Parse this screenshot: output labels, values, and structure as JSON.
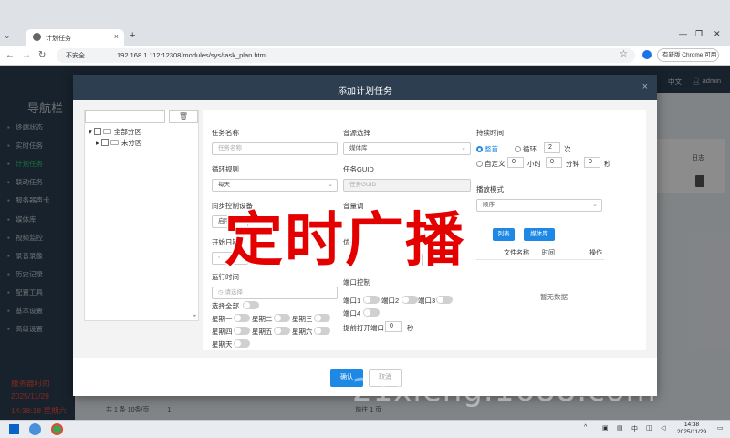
{
  "browser": {
    "tab_title": "计划任务",
    "tab_close": "×",
    "new_tab": "+",
    "window_controls": [
      "—",
      "❐",
      "✕"
    ],
    "insecure_label": "不安全",
    "url": "192.168.1.112:12308/modules/sys/task_plan.html",
    "update_label": "有新版 Chrome 可用"
  },
  "sidebar": {
    "title": "导航栏",
    "items": [
      {
        "label": "终端状态"
      },
      {
        "label": "实时任务"
      },
      {
        "label": "计划任务"
      },
      {
        "label": "联动任务"
      },
      {
        "label": "服务器声卡"
      },
      {
        "label": "媒体库"
      },
      {
        "label": "视频监控"
      },
      {
        "label": "录音录像"
      },
      {
        "label": "历史记录"
      },
      {
        "label": "配置工具"
      },
      {
        "label": "基本设置"
      },
      {
        "label": "高级设置"
      }
    ],
    "server_time_label": "服务器时间",
    "server_date": "2025/11/29",
    "server_clock": "14:38:18 星期六"
  },
  "topbar": {
    "lang": "中文",
    "user": "admin"
  },
  "background": {
    "log_header": "日志",
    "pager_text": "共 1 条   10条/页",
    "pager_page": "1",
    "pager_goto": "前往   1   页"
  },
  "modal": {
    "title": "添加计划任务",
    "close": "×",
    "tree": {
      "root": "全部分区",
      "child": "未分区"
    },
    "form": {
      "task_name_label": "任务名称",
      "task_name_placeholder": "任务名称",
      "source_label": "音源选择",
      "source_value": "媒体库",
      "duration_label": "持续时间",
      "whole_label": "整首",
      "loop_label": "循环",
      "loop_count": "2",
      "loop_unit": "次",
      "custom_label": "自定义",
      "hour_value": "0",
      "hour_unit": "小时",
      "min_value": "0",
      "min_unit": "分钟",
      "sec_value": "0",
      "sec_unit": "秒",
      "cycle_label": "循环规则",
      "cycle_value": "每天",
      "guid_label": "任务GUID",
      "guid_placeholder": "任务GUID",
      "play_mode_label": "播放模式",
      "play_mode_value": "顺序",
      "sync_label": "同步控制设备",
      "sync_value": "启用",
      "volume_label": "音量调",
      "start_date_label": "开始日期",
      "priority_label": "优先",
      "media_btn": "媒体库",
      "add_btn": "列表",
      "col_file": "文件名称",
      "col_time": "时间",
      "col_op": "操作",
      "no_data": "暂无数据",
      "run_time_label": "运行时间",
      "run_time_placeholder": "请选择",
      "select_all": "选择全部",
      "weekdays": [
        "星期一",
        "星期二",
        "星期三",
        "星期四",
        "星期五",
        "星期六",
        "星期天"
      ],
      "port_label": "端口控制",
      "ports": [
        "端口1",
        "端口2",
        "端口3",
        "端口4"
      ],
      "advance_label": "提前打开端口",
      "advance_value": "0",
      "advance_unit": "秒"
    },
    "ok": "确认",
    "cancel": "取消"
  },
  "overlay_text": {
    "banner": "定时广播",
    "watermark": "21xieng.1688.com"
  },
  "taskbar": {
    "ime": "中",
    "time": "14:38",
    "date": "2025/11/29"
  },
  "colors": {
    "sidebar_bg": "#2c3e50",
    "accent": "#1e88e5",
    "active_nav": "#2ecc71",
    "banner_red": "#e50000",
    "server_time_red": "#e74c3c"
  }
}
